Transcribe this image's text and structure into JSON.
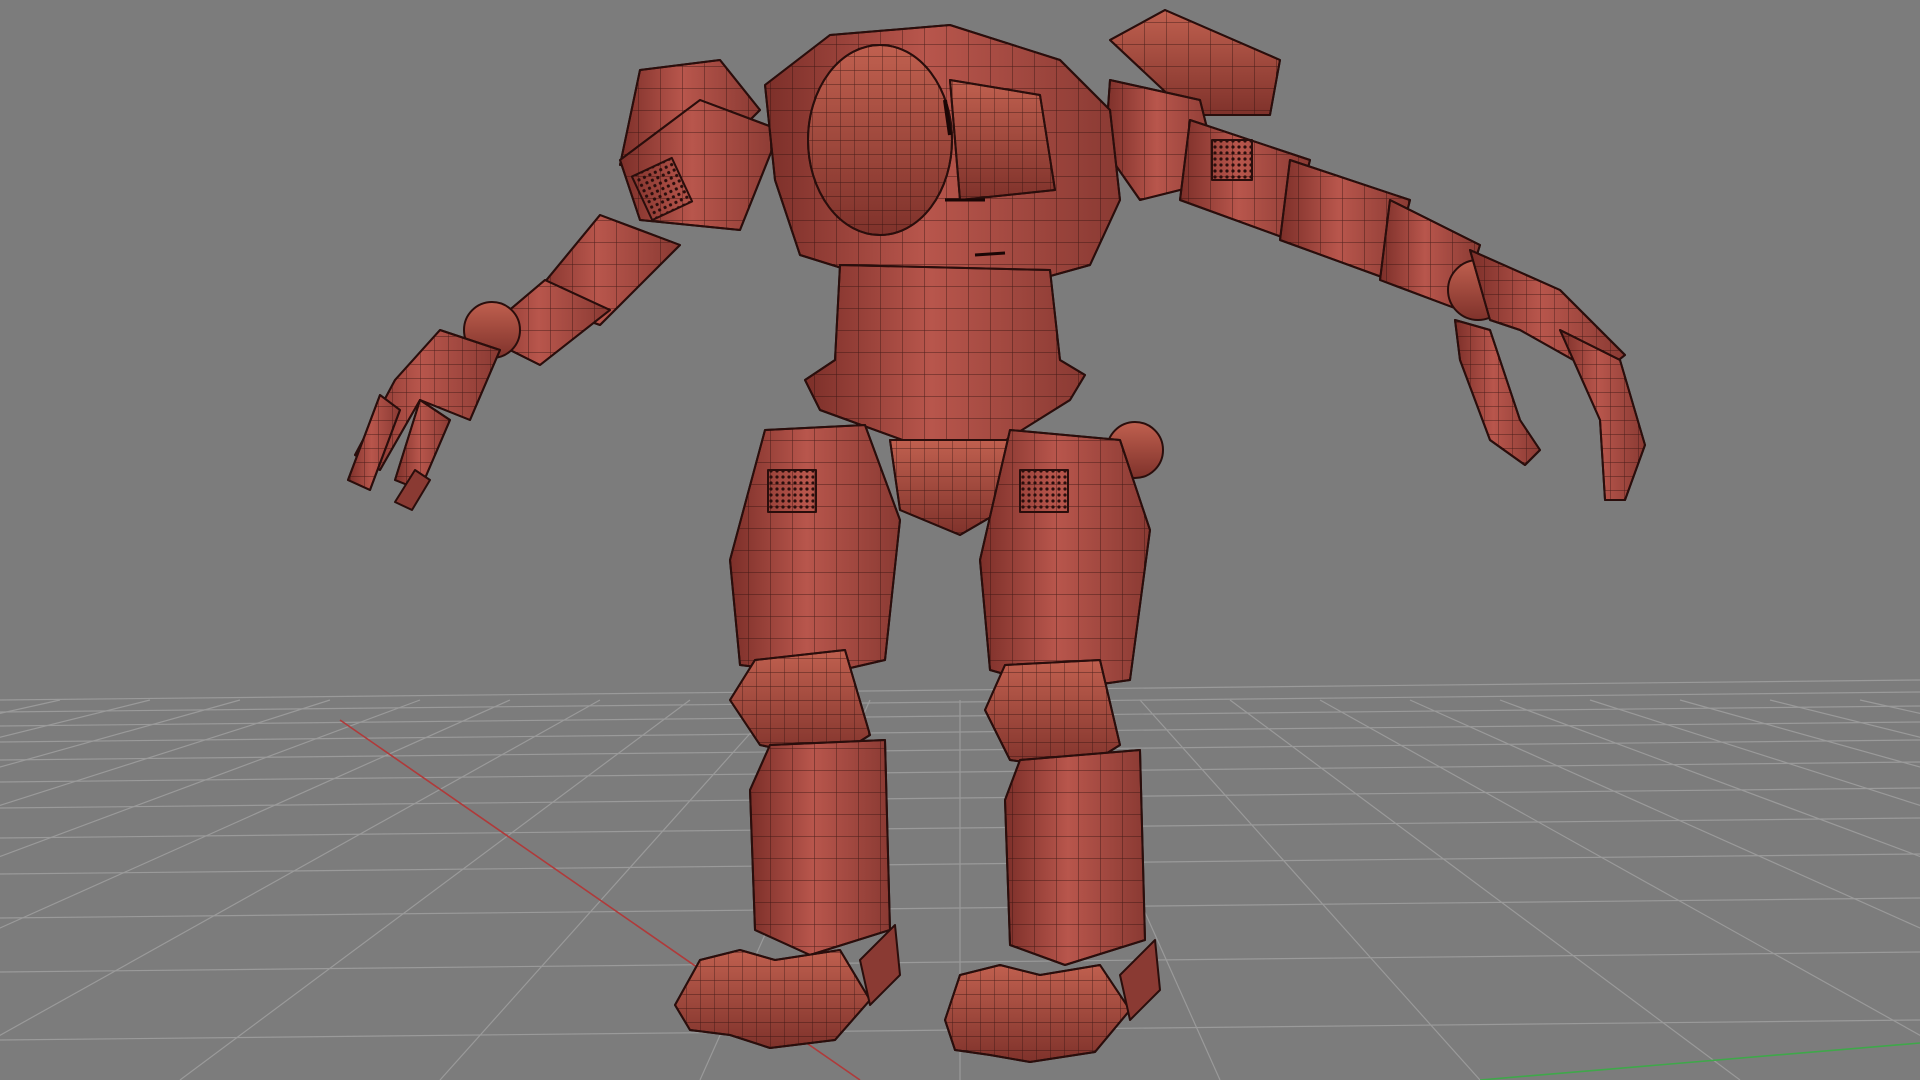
{
  "viewport": {
    "background_color": "#7c7c7c",
    "grid_line_color": "#9a9a9a",
    "x_axis_color": "#b03a3a",
    "z_axis_color": "#3fa84a",
    "model": {
      "name": "",
      "display_mode": "wireframe-on-shaded",
      "surface_color": "#a94b43",
      "surface_dark_color": "#7c2f29",
      "surface_light_color": "#c9675b",
      "wire_color": "#2a0e0c"
    }
  }
}
